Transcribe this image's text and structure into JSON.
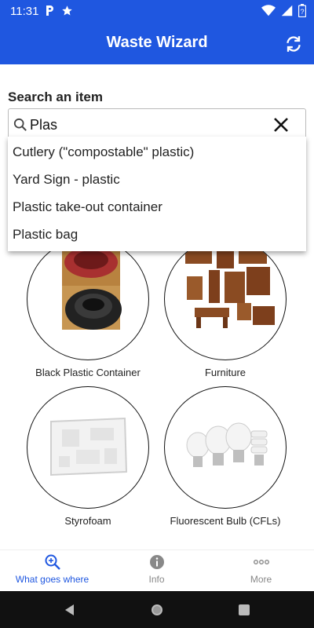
{
  "status_bar": {
    "time": "11:31",
    "left_icons": [
      "parking-icon",
      "star-icon"
    ],
    "right_icons": [
      "wifi-icon",
      "signal-icon",
      "battery-icon"
    ]
  },
  "app_bar": {
    "title": "Waste Wizard",
    "refresh_icon": "refresh-icon"
  },
  "search": {
    "label": "Search an item",
    "value": "Plas",
    "placeholder": ""
  },
  "suggestions": [
    "Cutlery (\"compostable\" plastic)",
    "Yard Sign - plastic",
    "Plastic take-out container",
    "Plastic bag"
  ],
  "categories": [
    {
      "label": "Black Plastic Container"
    },
    {
      "label": "Furniture"
    },
    {
      "label": "Styrofoam"
    },
    {
      "label": "Fluorescent Bulb (CFLs)"
    }
  ],
  "bottom_nav": [
    {
      "label": "What goes where",
      "active": true
    },
    {
      "label": "Info",
      "active": false
    },
    {
      "label": "More",
      "active": false
    }
  ],
  "colors": {
    "primary": "#1f57e0",
    "active_nav": "#1f57e0",
    "inactive_nav": "#888888"
  }
}
